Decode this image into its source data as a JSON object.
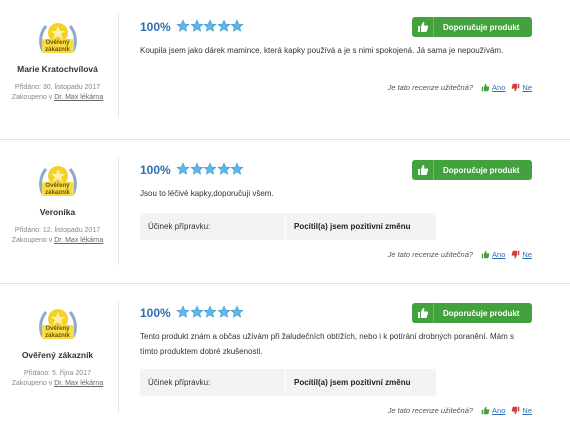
{
  "colors": {
    "accent": "#43a23e",
    "star": "#5fb6e8",
    "link": "#2b6fb0",
    "thumb_down": "#d04040"
  },
  "reviews": [
    {
      "badge": "Ověřený zákazník",
      "author": "Marie Kratochvílová",
      "added": "Přidáno: 30. listopadu 2017",
      "bought_prefix": "Zakoupeno v",
      "bought_store": "Dr. Max lékárna",
      "rating": "100%",
      "stars": 5,
      "recommend": "Doporučuje produkt",
      "text": "Koupila jsem jako dárek mamince, která kapky používá a je s nimi spokojená. Já sama je nepoužívám.",
      "useful_q": "Je tato recenze užitečná?",
      "yes": "Ano",
      "no": "Ne"
    },
    {
      "badge": "Ověřený zákazník",
      "author": "Veronika",
      "added": "Přidáno: 12. listopadu 2017",
      "bought_prefix": "Zakoupeno v",
      "bought_store": "Dr. Max lékárna",
      "rating": "100%",
      "stars": 5,
      "recommend": "Doporučuje produkt",
      "text": "Jsou to léčivé kapky,doporučuji všem.",
      "effect_label": "Účinek přípravku:",
      "effect_value": "Pocítil(a) jsem pozitivní změnu",
      "useful_q": "Je tato recenze užitečná?",
      "yes": "Ano",
      "no": "Ne"
    },
    {
      "badge": "Ověřený zákazník",
      "author": "Ověřený zákazník",
      "added": "Přidáno: 5. října 2017",
      "bought_prefix": "Zakoupeno v",
      "bought_store": "Dr. Max lékárna",
      "rating": "100%",
      "stars": 5,
      "recommend": "Doporučuje produkt",
      "text": "Tento produkt znám a občas užívám při žaludečních obtížích, nebo i k potírání drobných poranění. Mám s tímto produktem dobré zkušenosti.",
      "effect_label": "Účinek přípravku:",
      "effect_value": "Pocítil(a) jsem pozitivní změnu",
      "useful_q": "Je tato recenze užitečná?",
      "yes": "Ano",
      "no": "Ne"
    }
  ]
}
